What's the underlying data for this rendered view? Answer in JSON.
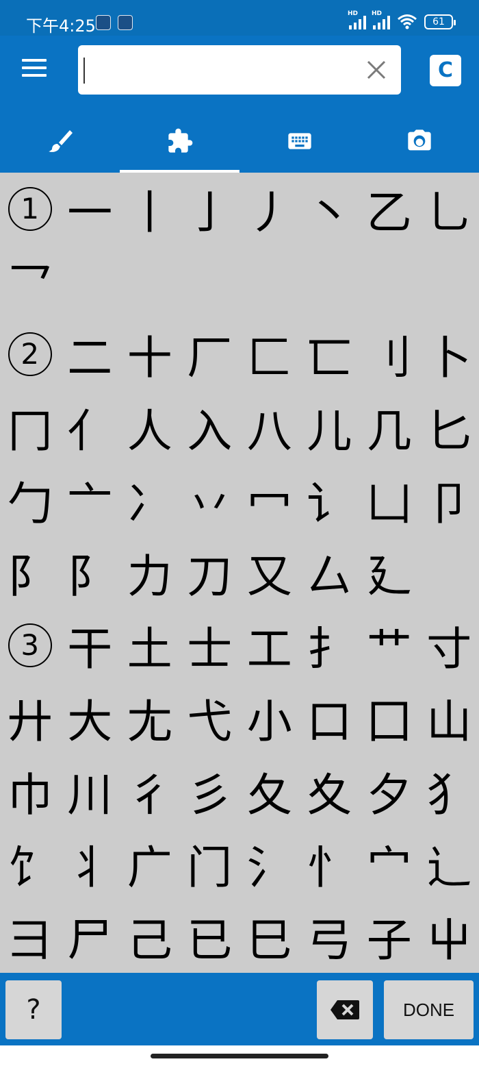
{
  "status_bar": {
    "time": "下午4:25",
    "signal1_label": "HD",
    "signal2_label": "HD",
    "battery": "61"
  },
  "header": {
    "search": {
      "value": "",
      "placeholder": ""
    },
    "c_button_label": "C",
    "tabs": [
      {
        "icon": "brush-icon",
        "selected": false
      },
      {
        "icon": "puzzle-icon",
        "selected": true
      },
      {
        "icon": "keyboard-icon",
        "selected": false
      },
      {
        "icon": "camera-icon",
        "selected": false
      }
    ]
  },
  "radical_rows": [
    [
      "①",
      "一",
      "丨",
      "亅",
      "丿",
      "丶",
      "乙",
      "乚"
    ],
    [
      "乛"
    ],
    [
      "②",
      "二",
      "十",
      "厂",
      "匚",
      "匸",
      "刂",
      "卜"
    ],
    [
      "冂",
      "亻",
      "人",
      "入",
      "八",
      "儿",
      "几",
      "匕"
    ],
    [
      "勹",
      "亠",
      "冫",
      "丷",
      "冖",
      "讠",
      "凵",
      "卩"
    ],
    [
      "阝",
      "阝",
      "力",
      "刀",
      "又",
      "厶",
      "廴"
    ],
    [
      "③",
      "干",
      "土",
      "士",
      "工",
      "扌",
      "艹",
      "寸"
    ],
    [
      "廾",
      "大",
      "尢",
      "弋",
      "小",
      "口",
      "囗",
      "山"
    ],
    [
      "巾",
      "川",
      "彳",
      "彡",
      "夂",
      "夊",
      "夕",
      "犭"
    ],
    [
      "饣",
      "丬",
      "广",
      "门",
      "氵",
      "忄",
      "宀",
      "辶"
    ],
    [
      "彐",
      "尸",
      "己",
      "已",
      "巳",
      "弓",
      "子",
      "屮"
    ]
  ],
  "stroke_number_indices": [
    {
      "row": 0,
      "col": 0
    },
    {
      "row": 2,
      "col": 0
    },
    {
      "row": 6,
      "col": 0
    }
  ],
  "bottom_bar": {
    "help_label": "?",
    "done_label": "DONE"
  },
  "colors": {
    "primary": "#0a73c3",
    "grid_bg": "#cccccc",
    "key_bg": "#d6d6d6"
  }
}
